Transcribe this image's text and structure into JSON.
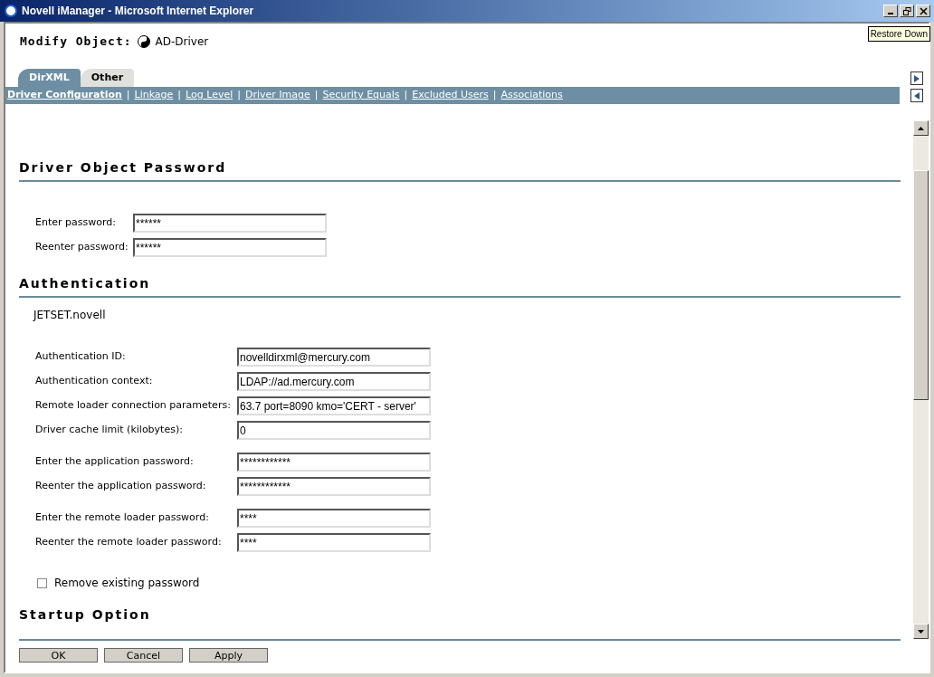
{
  "window": {
    "title": "Novell iManager - Microsoft Internet Explorer",
    "tooltip": "Restore Down"
  },
  "header": {
    "label": "Modify Object:",
    "object": "AD-Driver"
  },
  "tabs": [
    {
      "label": "DirXML",
      "selected": true
    },
    {
      "label": "Other",
      "selected": false
    }
  ],
  "link_separator": "|",
  "links": [
    {
      "label": "Driver Configuration",
      "selected": true
    },
    {
      "label": "Linkage",
      "selected": false
    },
    {
      "label": "Log Level",
      "selected": false
    },
    {
      "label": "Driver Image",
      "selected": false
    },
    {
      "label": "Security Equals",
      "selected": false
    },
    {
      "label": "Excluded Users",
      "selected": false
    },
    {
      "label": "Associations",
      "selected": false
    }
  ],
  "sections": [
    {
      "title": "Driver Object Password",
      "groups": [
        [
          {
            "label": "Enter password:",
            "value": "******"
          },
          {
            "label": "Reenter password:",
            "value": "******"
          }
        ]
      ]
    },
    {
      "title": "Authentication",
      "subtitle": "JETSET.novell",
      "groups": [
        [
          {
            "label": "Authentication ID:",
            "value": "novelldirxml@mercury.com"
          },
          {
            "label": "Authentication context:",
            "value": "LDAP://ad.mercury.com"
          },
          {
            "label": "Remote loader connection parameters:",
            "value": "63.7 port=8090 kmo='CERT - server'"
          },
          {
            "label": "Driver cache limit (kilobytes):",
            "value": "0"
          }
        ],
        [
          {
            "label": "Enter the application password:",
            "value": "************"
          },
          {
            "label": "Reenter the application password:",
            "value": "************"
          }
        ],
        [
          {
            "label": "Enter the remote loader password:",
            "value": "****"
          },
          {
            "label": "Reenter the remote loader password:",
            "value": "****"
          }
        ]
      ],
      "checkbox": {
        "label": "Remove existing password",
        "checked": false
      }
    },
    {
      "title": "Startup Option"
    }
  ],
  "buttons": [
    "OK",
    "Cancel",
    "Apply"
  ]
}
